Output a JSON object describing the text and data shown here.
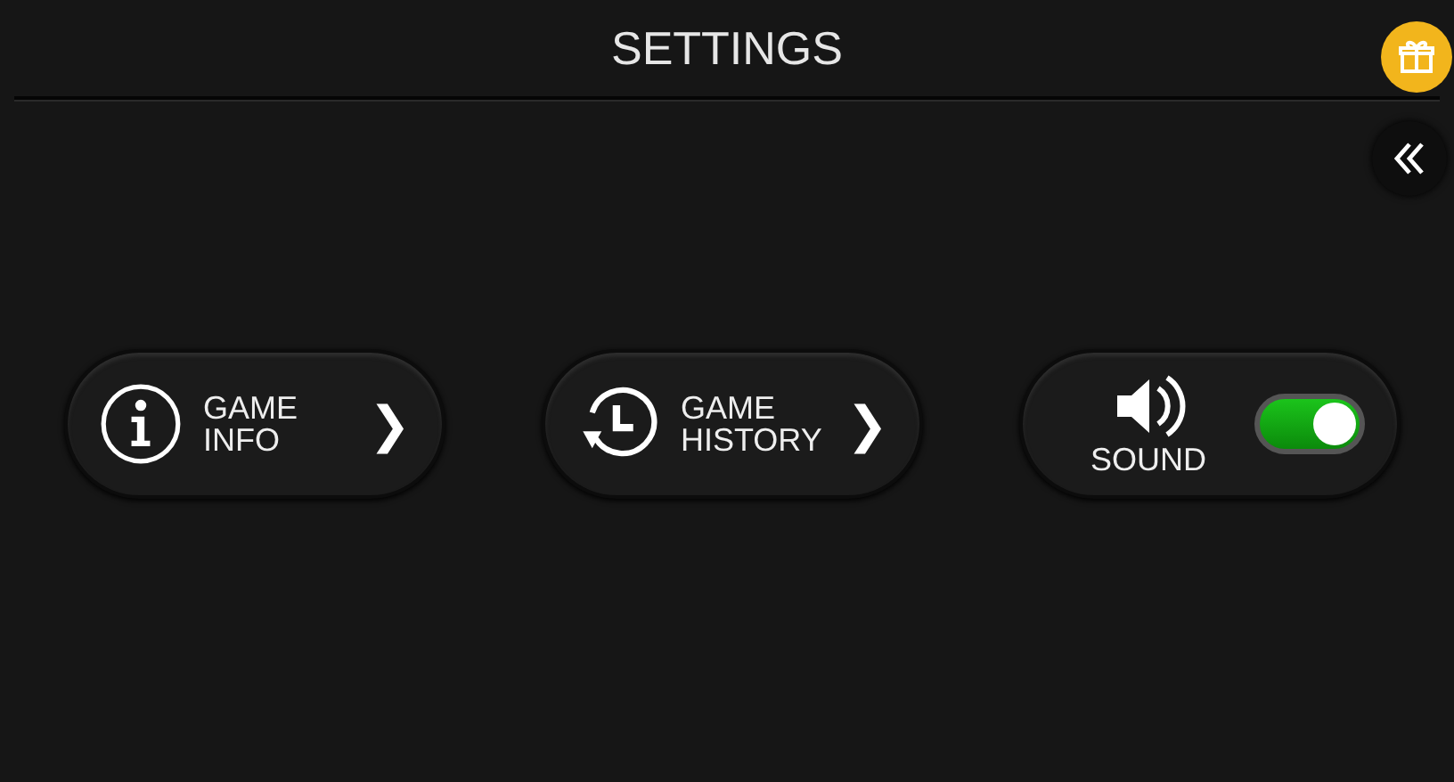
{
  "header": {
    "title": "SETTINGS"
  },
  "items": [
    {
      "kind": "link",
      "label": "GAME INFO",
      "chevron": "❯"
    },
    {
      "kind": "link",
      "label": "GAME HISTORY",
      "chevron": "❯"
    },
    {
      "kind": "toggle",
      "label": "SOUND",
      "on": true
    }
  ]
}
